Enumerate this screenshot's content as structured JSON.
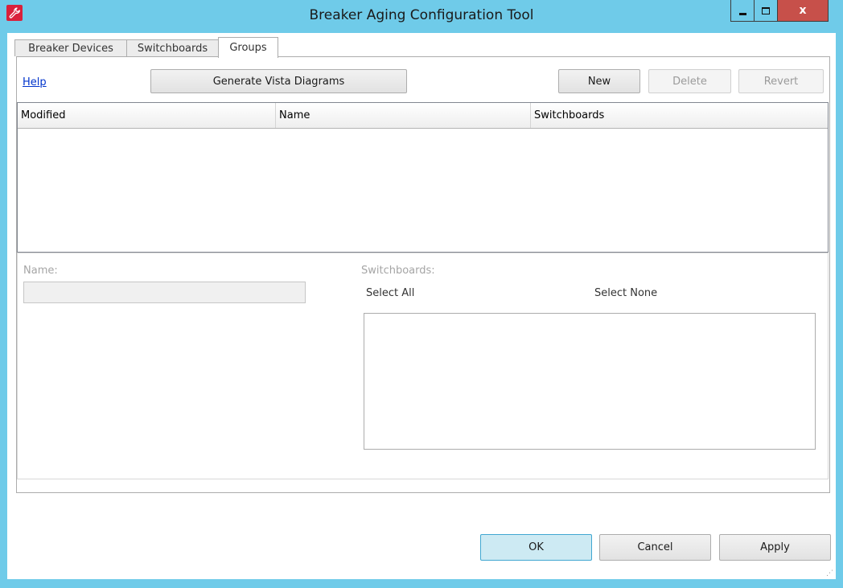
{
  "window": {
    "title": "Breaker Aging Configuration Tool",
    "icon": "wrench-app-icon",
    "controls": {
      "minimize": "minimize-icon",
      "maximize": "maximize-icon",
      "close_label": "x"
    },
    "accent_color": "#6fcbe9",
    "close_color": "#c7504a"
  },
  "tabs": [
    {
      "label": "Breaker Devices",
      "selected": false
    },
    {
      "label": "Switchboards",
      "selected": false
    },
    {
      "label": "Groups",
      "selected": true
    }
  ],
  "toolbar": {
    "help_label": "Help",
    "generate_label": "Generate Vista Diagrams",
    "new_label": "New",
    "delete_label": "Delete",
    "revert_label": "Revert"
  },
  "grid": {
    "columns": [
      "Modified",
      "Name",
      "Switchboards"
    ],
    "rows": []
  },
  "details": {
    "name_label": "Name:",
    "name_value": "",
    "switchboards_label": "Switchboards:",
    "select_all_label": "Select All",
    "select_none_label": "Select None",
    "switchboard_items": []
  },
  "footer": {
    "ok_label": "OK",
    "cancel_label": "Cancel",
    "apply_label": "Apply"
  }
}
